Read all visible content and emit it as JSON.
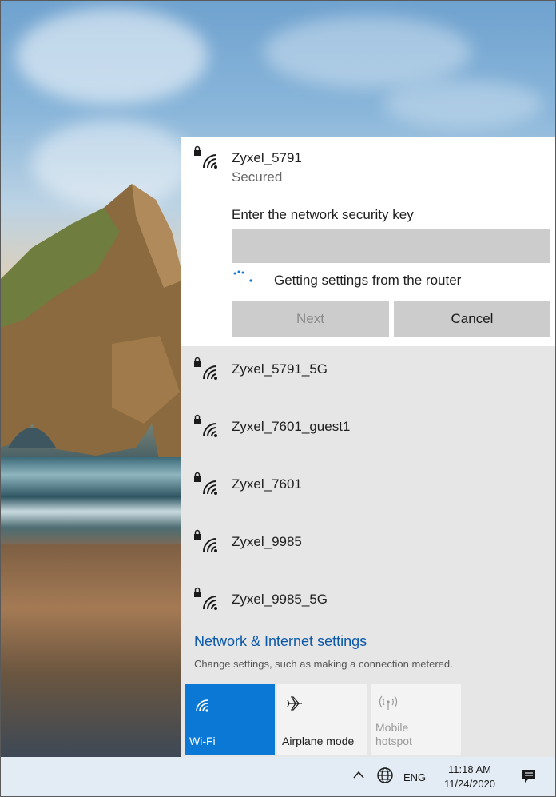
{
  "colors": {
    "accent": "#0a78d4",
    "link": "#0a58a8",
    "flyout_bg": "#e6e6e6",
    "taskbar_bg": "#e3ecf4"
  },
  "connecting_network": {
    "name": "Zyxel_5791",
    "status": "Secured",
    "icon": "wifi-secured-icon",
    "key_label": "Enter the network security key",
    "key_value": "",
    "progress_text": "Getting settings from the router",
    "next_label": "Next",
    "cancel_label": "Cancel"
  },
  "networks": [
    {
      "name": "Zyxel_5791_5G",
      "icon": "wifi-secured-icon"
    },
    {
      "name": "Zyxel_7601_guest1",
      "icon": "wifi-secured-icon"
    },
    {
      "name": "Zyxel_7601",
      "icon": "wifi-secured-icon"
    },
    {
      "name": "Zyxel_9985",
      "icon": "wifi-secured-icon"
    },
    {
      "name": "Zyxel_9985_5G",
      "icon": "wifi-secured-icon"
    }
  ],
  "settings": {
    "link": "Network & Internet settings",
    "description": "Change settings, such as making a connection metered."
  },
  "quick_actions": [
    {
      "label": "Wi-Fi",
      "icon": "wifi-icon",
      "state": "on"
    },
    {
      "label": "Airplane mode",
      "icon": "airplane-icon",
      "state": "off"
    },
    {
      "label_line1": "Mobile",
      "label_line2": "hotspot",
      "icon": "hotspot-icon",
      "state": "disabled"
    }
  ],
  "taskbar": {
    "language": "ENG",
    "time": "11:18 AM",
    "date": "11/24/2020",
    "icons": [
      "chevron-up-icon",
      "globe-icon",
      "notification-icon"
    ]
  }
}
